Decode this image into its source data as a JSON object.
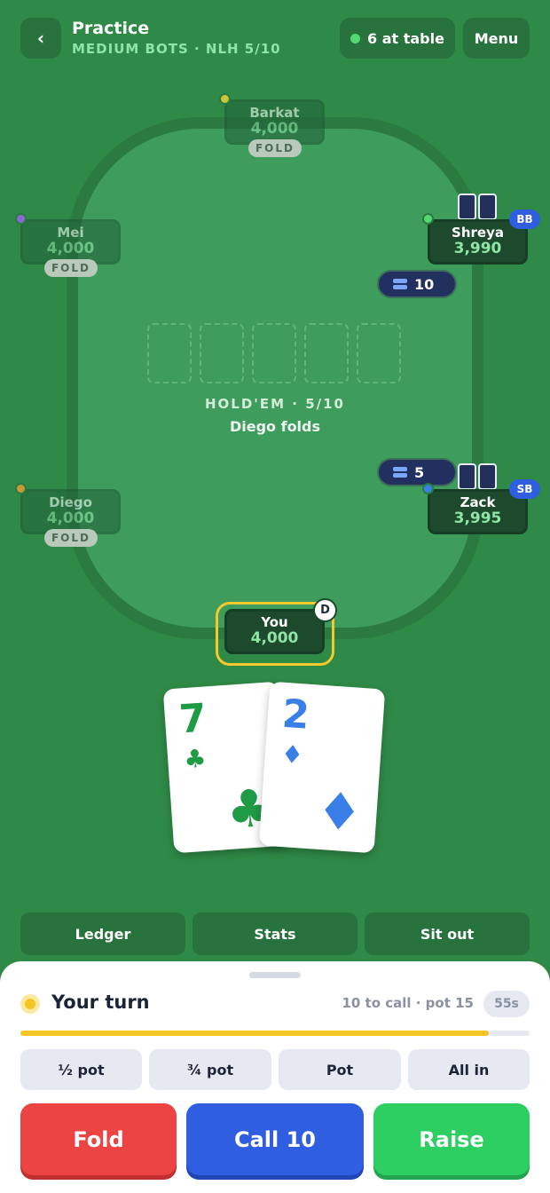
{
  "header": {
    "title": "Practice",
    "subtitle": "MEDIUM BOTS · NLH 5/10",
    "back_icon": "‹",
    "players_label": "6 at table",
    "menu_label": "Menu"
  },
  "table": {
    "game_label": "HOLD'EM · 5/10",
    "status": "Diego folds",
    "board_slots": 5
  },
  "seats": {
    "barkat": {
      "name": "Barkat",
      "stack": "4,000",
      "badge": "FOLD",
      "dot_color": "#c9c43a"
    },
    "mei": {
      "name": "Mei",
      "stack": "4,000",
      "badge": "FOLD",
      "dot_color": "#8a6ad8"
    },
    "diego": {
      "name": "Diego",
      "stack": "4,000",
      "badge": "FOLD",
      "dot_color": "#c99a3a"
    },
    "shreya": {
      "name": "Shreya",
      "stack": "3,990",
      "blind": "BB",
      "bet": "10",
      "dot_color": "#52d973"
    },
    "zack": {
      "name": "Zack",
      "stack": "3,995",
      "blind": "SB",
      "bet": "5",
      "dot_color": "#3a7ee8"
    },
    "you": {
      "name": "You",
      "stack": "4,000",
      "dealer": "D"
    }
  },
  "hand": [
    {
      "rank": "7",
      "suit": "♣",
      "suit_name": "clubs",
      "color": "#1f9a45"
    },
    {
      "rank": "2",
      "suit": "♦",
      "suit_name": "diamonds",
      "color": "#3a7ee8"
    }
  ],
  "secondary_actions": {
    "ledger": "Ledger",
    "stats": "Stats",
    "sit_out": "Sit out"
  },
  "turn_panel": {
    "title": "Your turn",
    "info": "10 to call · pot 15",
    "timer": "55s",
    "timer_progress": 0.92,
    "sizing": [
      "½ pot",
      "¾ pot",
      "Pot",
      "All in"
    ],
    "fold_label": "Fold",
    "call_label": "Call 10",
    "raise_label": "Raise"
  }
}
